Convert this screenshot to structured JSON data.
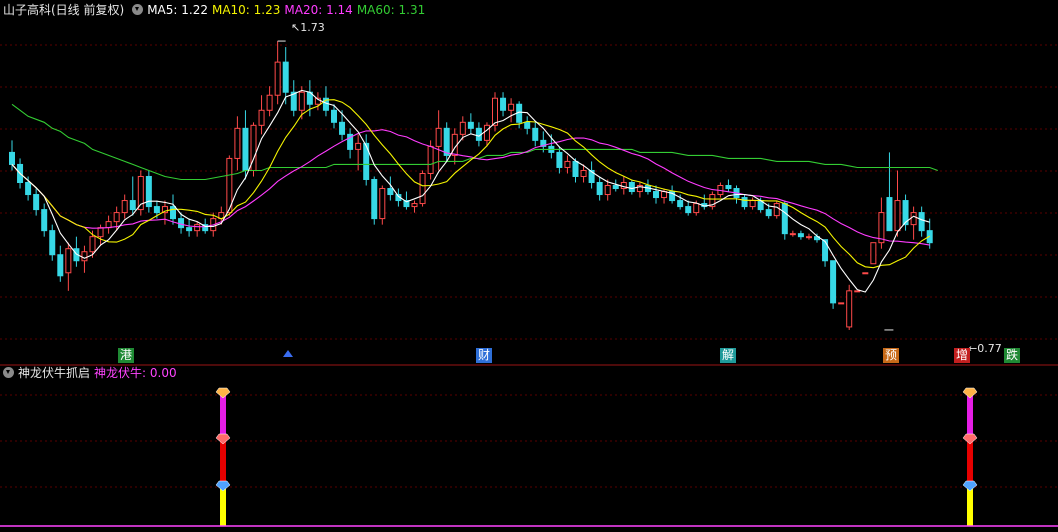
{
  "header": {
    "title": "山子高科(日线 前复权)",
    "ma": [
      {
        "label": "MA5: 1.22",
        "color": "#ffffff"
      },
      {
        "label": "MA10: 1.23",
        "color": "#f4f400"
      },
      {
        "label": "MA20: 1.14",
        "color": "#ff3cff"
      },
      {
        "label": "MA60: 1.31",
        "color": "#33cc33"
      }
    ]
  },
  "indicator": {
    "title": "神龙伏牛抓启",
    "value_label": "神龙伏牛: 0.00",
    "value_color": "#ff44ff"
  },
  "annotations": {
    "max_label": "1.73",
    "min_label": "0.77"
  },
  "event_labels": [
    {
      "text": "港",
      "color": "green"
    },
    {
      "text": "财",
      "color": "blue"
    },
    {
      "text": "解",
      "color": "teal"
    },
    {
      "text": "预",
      "color": "orange"
    },
    {
      "text": "增",
      "color": "red"
    },
    {
      "text": "跌",
      "color": "green"
    }
  ],
  "colors": {
    "up": "#ff4a4a",
    "down": "#37d8e6",
    "ma5": "#ffffff",
    "ma10": "#f4f400",
    "ma20": "#ff3cff",
    "ma60": "#33cc33",
    "grid": "#5a0000",
    "axis": "#9b1515"
  },
  "chart_data": {
    "type": "candlestick",
    "ylim": [
      0.72,
      1.8
    ],
    "candles": [
      [
        1.36,
        1.4,
        1.3,
        1.32
      ],
      [
        1.32,
        1.34,
        1.24,
        1.26
      ],
      [
        1.26,
        1.28,
        1.2,
        1.22
      ],
      [
        1.22,
        1.24,
        1.15,
        1.17
      ],
      [
        1.17,
        1.19,
        1.08,
        1.1
      ],
      [
        1.1,
        1.12,
        1.0,
        1.02
      ],
      [
        1.02,
        1.05,
        0.93,
        0.95
      ],
      [
        0.96,
        1.06,
        0.9,
        1.04
      ],
      [
        1.04,
        1.08,
        0.98,
        1.0
      ],
      [
        1.0,
        1.05,
        0.96,
        1.03
      ],
      [
        1.03,
        1.1,
        1.01,
        1.08
      ],
      [
        1.08,
        1.12,
        1.05,
        1.11
      ],
      [
        1.11,
        1.15,
        1.09,
        1.13
      ],
      [
        1.13,
        1.18,
        1.1,
        1.16
      ],
      [
        1.16,
        1.22,
        1.14,
        1.2
      ],
      [
        1.2,
        1.28,
        1.15,
        1.17
      ],
      [
        1.17,
        1.3,
        1.15,
        1.28
      ],
      [
        1.28,
        1.3,
        1.16,
        1.18
      ],
      [
        1.18,
        1.2,
        1.14,
        1.16
      ],
      [
        1.16,
        1.2,
        1.12,
        1.18
      ],
      [
        1.18,
        1.22,
        1.12,
        1.14
      ],
      [
        1.14,
        1.16,
        1.09,
        1.11
      ],
      [
        1.11,
        1.14,
        1.08,
        1.1
      ],
      [
        1.1,
        1.13,
        1.08,
        1.12
      ],
      [
        1.12,
        1.14,
        1.09,
        1.1
      ],
      [
        1.1,
        1.16,
        1.08,
        1.14
      ],
      [
        1.14,
        1.18,
        1.12,
        1.16
      ],
      [
        1.16,
        1.35,
        1.15,
        1.34
      ],
      [
        1.34,
        1.48,
        1.3,
        1.44
      ],
      [
        1.44,
        1.5,
        1.27,
        1.3
      ],
      [
        1.3,
        1.46,
        1.28,
        1.45
      ],
      [
        1.45,
        1.55,
        1.42,
        1.5
      ],
      [
        1.5,
        1.58,
        1.48,
        1.55
      ],
      [
        1.55,
        1.73,
        1.52,
        1.66
      ],
      [
        1.66,
        1.71,
        1.52,
        1.56
      ],
      [
        1.56,
        1.6,
        1.48,
        1.5
      ],
      [
        1.5,
        1.58,
        1.47,
        1.56
      ],
      [
        1.56,
        1.6,
        1.48,
        1.52
      ],
      [
        1.52,
        1.56,
        1.5,
        1.54
      ],
      [
        1.54,
        1.58,
        1.48,
        1.5
      ],
      [
        1.5,
        1.52,
        1.44,
        1.46
      ],
      [
        1.46,
        1.5,
        1.4,
        1.42
      ],
      [
        1.42,
        1.44,
        1.34,
        1.37
      ],
      [
        1.37,
        1.42,
        1.3,
        1.39
      ],
      [
        1.39,
        1.42,
        1.25,
        1.27
      ],
      [
        1.27,
        1.28,
        1.12,
        1.14
      ],
      [
        1.14,
        1.25,
        1.12,
        1.24
      ],
      [
        1.24,
        1.28,
        1.2,
        1.22
      ],
      [
        1.22,
        1.24,
        1.18,
        1.2
      ],
      [
        1.2,
        1.23,
        1.17,
        1.18
      ],
      [
        1.18,
        1.2,
        1.16,
        1.19
      ],
      [
        1.19,
        1.3,
        1.18,
        1.29
      ],
      [
        1.29,
        1.4,
        1.27,
        1.38
      ],
      [
        1.38,
        1.5,
        1.3,
        1.44
      ],
      [
        1.44,
        1.46,
        1.33,
        1.35
      ],
      [
        1.35,
        1.44,
        1.32,
        1.42
      ],
      [
        1.42,
        1.48,
        1.4,
        1.46
      ],
      [
        1.46,
        1.49,
        1.42,
        1.44
      ],
      [
        1.44,
        1.46,
        1.38,
        1.4
      ],
      [
        1.4,
        1.46,
        1.38,
        1.45
      ],
      [
        1.45,
        1.56,
        1.43,
        1.54
      ],
      [
        1.54,
        1.56,
        1.48,
        1.5
      ],
      [
        1.5,
        1.54,
        1.46,
        1.52
      ],
      [
        1.52,
        1.53,
        1.44,
        1.46
      ],
      [
        1.46,
        1.48,
        1.42,
        1.44
      ],
      [
        1.44,
        1.46,
        1.38,
        1.4
      ],
      [
        1.4,
        1.43,
        1.36,
        1.38
      ],
      [
        1.38,
        1.42,
        1.34,
        1.36
      ],
      [
        1.36,
        1.38,
        1.29,
        1.31
      ],
      [
        1.31,
        1.35,
        1.29,
        1.33
      ],
      [
        1.33,
        1.34,
        1.26,
        1.28
      ],
      [
        1.28,
        1.32,
        1.26,
        1.3
      ],
      [
        1.3,
        1.33,
        1.24,
        1.26
      ],
      [
        1.26,
        1.28,
        1.2,
        1.22
      ],
      [
        1.22,
        1.27,
        1.2,
        1.25
      ],
      [
        1.25,
        1.27,
        1.23,
        1.24
      ],
      [
        1.24,
        1.28,
        1.22,
        1.26
      ],
      [
        1.26,
        1.27,
        1.22,
        1.23
      ],
      [
        1.23,
        1.26,
        1.21,
        1.25
      ],
      [
        1.25,
        1.27,
        1.22,
        1.23
      ],
      [
        1.23,
        1.25,
        1.19,
        1.21
      ],
      [
        1.21,
        1.24,
        1.19,
        1.23
      ],
      [
        1.23,
        1.25,
        1.19,
        1.2
      ],
      [
        1.2,
        1.22,
        1.17,
        1.18
      ],
      [
        1.18,
        1.2,
        1.15,
        1.16
      ],
      [
        1.16,
        1.2,
        1.15,
        1.19
      ],
      [
        1.19,
        1.22,
        1.17,
        1.18
      ],
      [
        1.18,
        1.23,
        1.17,
        1.22
      ],
      [
        1.22,
        1.26,
        1.21,
        1.25
      ],
      [
        1.25,
        1.27,
        1.23,
        1.24
      ],
      [
        1.24,
        1.25,
        1.19,
        1.21
      ],
      [
        1.21,
        1.22,
        1.17,
        1.18
      ],
      [
        1.18,
        1.21,
        1.17,
        1.2
      ],
      [
        1.2,
        1.21,
        1.16,
        1.17
      ],
      [
        1.17,
        1.19,
        1.14,
        1.15
      ],
      [
        1.15,
        1.2,
        1.14,
        1.19
      ],
      [
        1.19,
        1.2,
        1.07,
        1.09
      ],
      [
        1.09,
        1.1,
        1.08,
        1.09
      ],
      [
        1.09,
        1.1,
        1.07,
        1.08
      ],
      [
        1.08,
        1.09,
        1.07,
        1.08
      ],
      [
        1.08,
        1.09,
        1.06,
        1.07
      ],
      [
        1.07,
        1.07,
        0.98,
        1.0
      ],
      [
        1.0,
        1.0,
        0.84,
        0.86
      ],
      [
        0.86,
        0.86,
        0.86,
        0.86
      ],
      [
        0.78,
        0.92,
        0.77,
        0.9
      ],
      [
        0.9,
        0.9,
        0.9,
        0.9
      ],
      [
        0.96,
        0.96,
        0.96,
        0.96
      ],
      [
        0.99,
        1.06,
        0.99,
        1.06
      ],
      [
        1.06,
        1.21,
        1.04,
        1.16
      ],
      [
        1.21,
        1.36,
        1.13,
        1.1
      ],
      [
        1.1,
        1.3,
        1.08,
        1.2
      ],
      [
        1.2,
        1.22,
        1.1,
        1.12
      ],
      [
        1.12,
        1.18,
        1.07,
        1.16
      ],
      [
        1.16,
        1.18,
        1.08,
        1.1
      ],
      [
        1.1,
        1.14,
        1.04,
        1.06
      ]
    ],
    "ma60": [
      1.52,
      1.5,
      1.48,
      1.47,
      1.46,
      1.44,
      1.43,
      1.41,
      1.4,
      1.39,
      1.37,
      1.36,
      1.35,
      1.34,
      1.33,
      1.32,
      1.31,
      1.3,
      1.29,
      1.28,
      1.275,
      1.27,
      1.27,
      1.27,
      1.27,
      1.275,
      1.28,
      1.285,
      1.29,
      1.3,
      1.3,
      1.3,
      1.31,
      1.31,
      1.31,
      1.31,
      1.31,
      1.31,
      1.31,
      1.31,
      1.32,
      1.32,
      1.32,
      1.32,
      1.32,
      1.32,
      1.32,
      1.32,
      1.32,
      1.32,
      1.32,
      1.32,
      1.32,
      1.33,
      1.33,
      1.33,
      1.33,
      1.34,
      1.34,
      1.35,
      1.35,
      1.35,
      1.36,
      1.36,
      1.36,
      1.37,
      1.37,
      1.37,
      1.37,
      1.37,
      1.37,
      1.37,
      1.37,
      1.37,
      1.37,
      1.37,
      1.37,
      1.37,
      1.36,
      1.36,
      1.36,
      1.36,
      1.36,
      1.355,
      1.35,
      1.35,
      1.35,
      1.35,
      1.345,
      1.34,
      1.34,
      1.34,
      1.34,
      1.34,
      1.335,
      1.33,
      1.33,
      1.33,
      1.33,
      1.33,
      1.325,
      1.32,
      1.32,
      1.32,
      1.315,
      1.31,
      1.31,
      1.31,
      1.31,
      1.31,
      1.31,
      1.31,
      1.31,
      1.31,
      1.31,
      1.3
    ]
  }
}
